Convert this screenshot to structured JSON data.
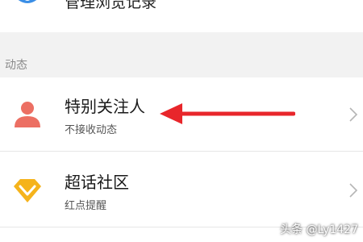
{
  "top_item": {
    "label": "管理浏览记录",
    "icon": "eye-icon"
  },
  "section": {
    "title": "动态"
  },
  "items": [
    {
      "title": "特别关注人",
      "subtitle": "不接收动态",
      "icon": "person-icon",
      "icon_color": "#ec6f63"
    },
    {
      "title": "超话社区",
      "subtitle": "红点提醒",
      "icon": "diamond-icon",
      "icon_color": "#f5b31b"
    }
  ],
  "annotation": {
    "arrow_color": "#e8262b"
  },
  "watermark": "头条 @Ly1427"
}
